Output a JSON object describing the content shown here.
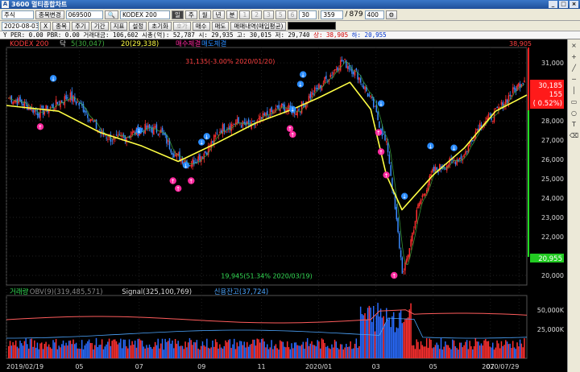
{
  "window": {
    "title": "3600 멀티종합차트",
    "logo": "A"
  },
  "toolbar1": {
    "market": "주식",
    "search_btn": "종목변경",
    "code": "069500",
    "name": "KODEX 200",
    "mode_btns": [
      "일",
      "주",
      "월",
      "년",
      "분"
    ],
    "num_btns": [
      "1",
      "2",
      "3",
      "5",
      "6",
      "30"
    ],
    "count": "359",
    "of": "879",
    "visible": "400"
  },
  "toolbar2": {
    "date": "2020-08-03",
    "btn_x": "X",
    "btn_stock": "종목",
    "btn_period": "주기",
    "btn_term": "기간",
    "btn_indicator": "지표",
    "btn_settings": "설정",
    "btn_reset": "초기화",
    "btn_check": "호가",
    "btn_buy": "매수",
    "btn_sell": "매도",
    "trade_label": "매매내역(",
    "avg_label": "매입평균)"
  },
  "info": {
    "text_a": "Y  PER: 0.00  PBR: 0.00  거래대금: 106,602  시총(억): 52,787  시: 29,935  고: 30,015  저: 29,740  ",
    "high_label": "상: 38,905",
    "text_b": "  하: 20,955"
  },
  "legend": {
    "name": "KODEX 200",
    "flag": "닥",
    "ma5": "5(30,047)",
    "ma20": "20(29,338)",
    "buy": "매수체결",
    "sell": "매도체결"
  },
  "vol_legend": {
    "vol": "거래량",
    "obv": "OBV(9)(319,485,571)",
    "signal": "Signal(325,100,769)",
    "credit": "신용잔고(37,724)"
  },
  "annotations": {
    "high": "31,135(-3.00% 2020/01/20)",
    "low": "19,945(51.34% 2020/03/19)",
    "top_price": "38,905",
    "bottom_price": "20,955"
  },
  "current": {
    "price": "30,185",
    "change": "155",
    "pct": "( 0.52%)"
  },
  "colors": {
    "up": "#ff3030",
    "down": "#3a8cff",
    "ma5": "#3fae3f",
    "ma20": "#ffff44",
    "buy": "#ff2aa0",
    "sell": "#2a8cff",
    "bg": "#000000",
    "obv": "#ff5c5c",
    "signal": "#4da6ff"
  },
  "chart_data": [
    {
      "type": "candlestick",
      "title": "KODEX 200",
      "ylim": [
        19500,
        31800
      ],
      "y_ticks": [
        20000,
        21000,
        22000,
        23000,
        24000,
        25000,
        26000,
        27000,
        28000,
        29000,
        30000,
        31000
      ],
      "x_ticks": [
        "2019/02/19",
        "05",
        "07",
        "09",
        "11",
        "2020/01",
        "03",
        "05",
        "07",
        "2020/07/29"
      ],
      "close_path": [
        [
          "2019/02/19",
          29200
        ],
        [
          "2019/03",
          28900
        ],
        [
          "2019/03-b",
          28400
        ],
        [
          "2019/04",
          28800
        ],
        [
          "2019/04-b",
          29300
        ],
        [
          "2019/05",
          28600
        ],
        [
          "2019/05-b",
          27400
        ],
        [
          "2019/06",
          27000
        ],
        [
          "2019/06-b",
          27300
        ],
        [
          "2019/07",
          27600
        ],
        [
          "2019/07-b",
          27500
        ],
        [
          "2019/08",
          26200
        ],
        [
          "2019/08-b",
          25800
        ],
        [
          "2019/09",
          26400
        ],
        [
          "2019/09-b",
          27600
        ],
        [
          "2019/10",
          27900
        ],
        [
          "2019/10-b",
          27700
        ],
        [
          "2019/11",
          28300
        ],
        [
          "2019/11-b",
          28700
        ],
        [
          "2019/12",
          28500
        ],
        [
          "2019/12-b",
          29400
        ],
        [
          "2020/01",
          30200
        ],
        [
          "2020/01-b",
          31135
        ],
        [
          "2020/02",
          30400
        ],
        [
          "2020/02-b",
          28900
        ],
        [
          "2020/03",
          26500
        ],
        [
          "2020/03-b",
          19945
        ],
        [
          "2020/04",
          23600
        ],
        [
          "2020/04-b",
          25400
        ],
        [
          "2020/05",
          25800
        ],
        [
          "2020/05-b",
          26200
        ],
        [
          "2020/06",
          27800
        ],
        [
          "2020/06-b",
          28300
        ],
        [
          "2020/07",
          29300
        ],
        [
          "2020/07/29",
          30185
        ]
      ],
      "ma20_path": [
        [
          0,
          28800
        ],
        [
          0.1,
          28500
        ],
        [
          0.18,
          27400
        ],
        [
          0.26,
          26700
        ],
        [
          0.33,
          25900
        ],
        [
          0.4,
          26800
        ],
        [
          0.48,
          27900
        ],
        [
          0.55,
          28600
        ],
        [
          0.6,
          29200
        ],
        [
          0.66,
          30000
        ],
        [
          0.7,
          28600
        ],
        [
          0.73,
          25200
        ],
        [
          0.76,
          23400
        ],
        [
          0.82,
          25200
        ],
        [
          0.88,
          26600
        ],
        [
          0.94,
          28500
        ],
        [
          1.0,
          29338
        ]
      ],
      "volume": {
        "ylabels": [
          "50,000K",
          "25,000K"
        ]
      }
    }
  ]
}
